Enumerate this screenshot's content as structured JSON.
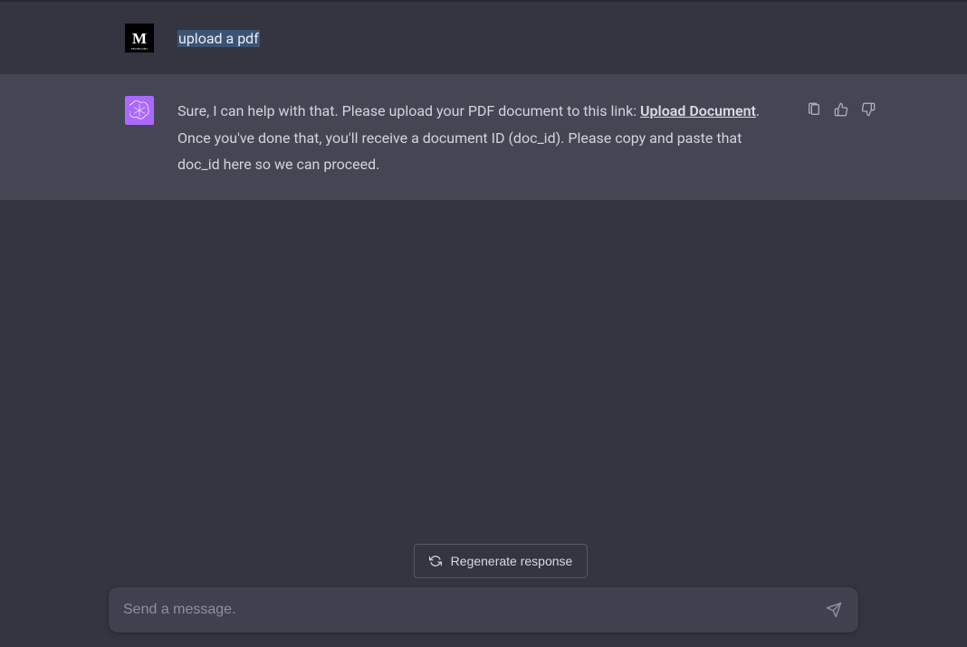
{
  "user_message": {
    "text": "upload a pdf"
  },
  "assistant_message": {
    "text_before_link": "Sure, I can help with that. Please upload your PDF document to this link: ",
    "link_text": "Upload Document",
    "text_after_link": ". Once you've done that, you'll receive a document ID (doc_id). Please copy and paste that doc_id here so we can proceed."
  },
  "regenerate": {
    "label": "Regenerate response"
  },
  "input": {
    "placeholder": "Send a message."
  }
}
